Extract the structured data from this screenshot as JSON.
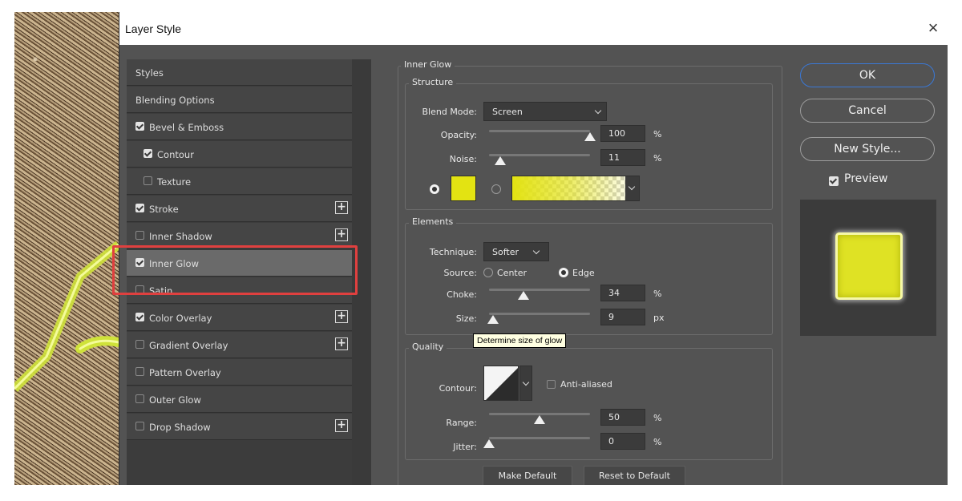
{
  "dialog": {
    "title": "Layer Style",
    "close_glyph": "×"
  },
  "styles_list": [
    {
      "label": "Styles",
      "checkbox": null,
      "plus": false
    },
    {
      "label": "Blending Options",
      "checkbox": null,
      "plus": false
    },
    {
      "label": "Bevel & Emboss",
      "checkbox": true,
      "plus": false
    },
    {
      "label": "Contour",
      "checkbox": true,
      "plus": false,
      "indent": true
    },
    {
      "label": "Texture",
      "checkbox": false,
      "plus": false,
      "indent": true
    },
    {
      "label": "Stroke",
      "checkbox": true,
      "plus": true
    },
    {
      "label": "Inner Shadow",
      "checkbox": false,
      "plus": true
    },
    {
      "label": "Inner Glow",
      "checkbox": true,
      "plus": false,
      "selected": true
    },
    {
      "label": "Satin",
      "checkbox": false,
      "plus": false
    },
    {
      "label": "Color Overlay",
      "checkbox": true,
      "plus": true
    },
    {
      "label": "Gradient Overlay",
      "checkbox": false,
      "plus": true
    },
    {
      "label": "Pattern Overlay",
      "checkbox": false,
      "plus": false
    },
    {
      "label": "Outer Glow",
      "checkbox": false,
      "plus": false
    },
    {
      "label": "Drop Shadow",
      "checkbox": false,
      "plus": true
    }
  ],
  "inner_glow": {
    "title": "Inner Glow",
    "structure": {
      "title": "Structure",
      "blend_mode_label": "Blend Mode:",
      "blend_mode": "Screen",
      "opacity_label": "Opacity:",
      "opacity": "100",
      "opacity_fraction": 1.0,
      "opacity_unit": "%",
      "noise_label": "Noise:",
      "noise": "11",
      "noise_fraction": 0.11,
      "noise_unit": "%",
      "glow_color": "#e3e312"
    },
    "elements": {
      "title": "Elements",
      "technique_label": "Technique:",
      "technique": "Softer",
      "source_label": "Source:",
      "source_center": "Center",
      "source_edge": "Edge",
      "choke_label": "Choke:",
      "choke": "34",
      "choke_fraction": 0.34,
      "choke_unit": "%",
      "size_label": "Size:",
      "size": "9",
      "size_fraction": 0.04,
      "size_unit": "px",
      "tooltip": "Determine size of glow"
    },
    "quality": {
      "title": "Quality",
      "contour_label": "Contour:",
      "anti_aliased_label": "Anti-aliased",
      "range_label": "Range:",
      "range": "50",
      "range_fraction": 0.5,
      "range_unit": "%",
      "jitter_label": "Jitter:",
      "jitter": "0",
      "jitter_fraction": 0.0,
      "jitter_unit": "%"
    },
    "make_default": "Make Default",
    "reset_default": "Reset to Default"
  },
  "buttons": {
    "ok": "OK",
    "cancel": "Cancel",
    "new_style": "New Style..."
  },
  "preview": {
    "label": "Preview",
    "checked": true
  },
  "colors": {
    "accent_blue": "#3a78d6",
    "highlight_red": "#e0403f",
    "glow_yellow": "#e3e312"
  }
}
